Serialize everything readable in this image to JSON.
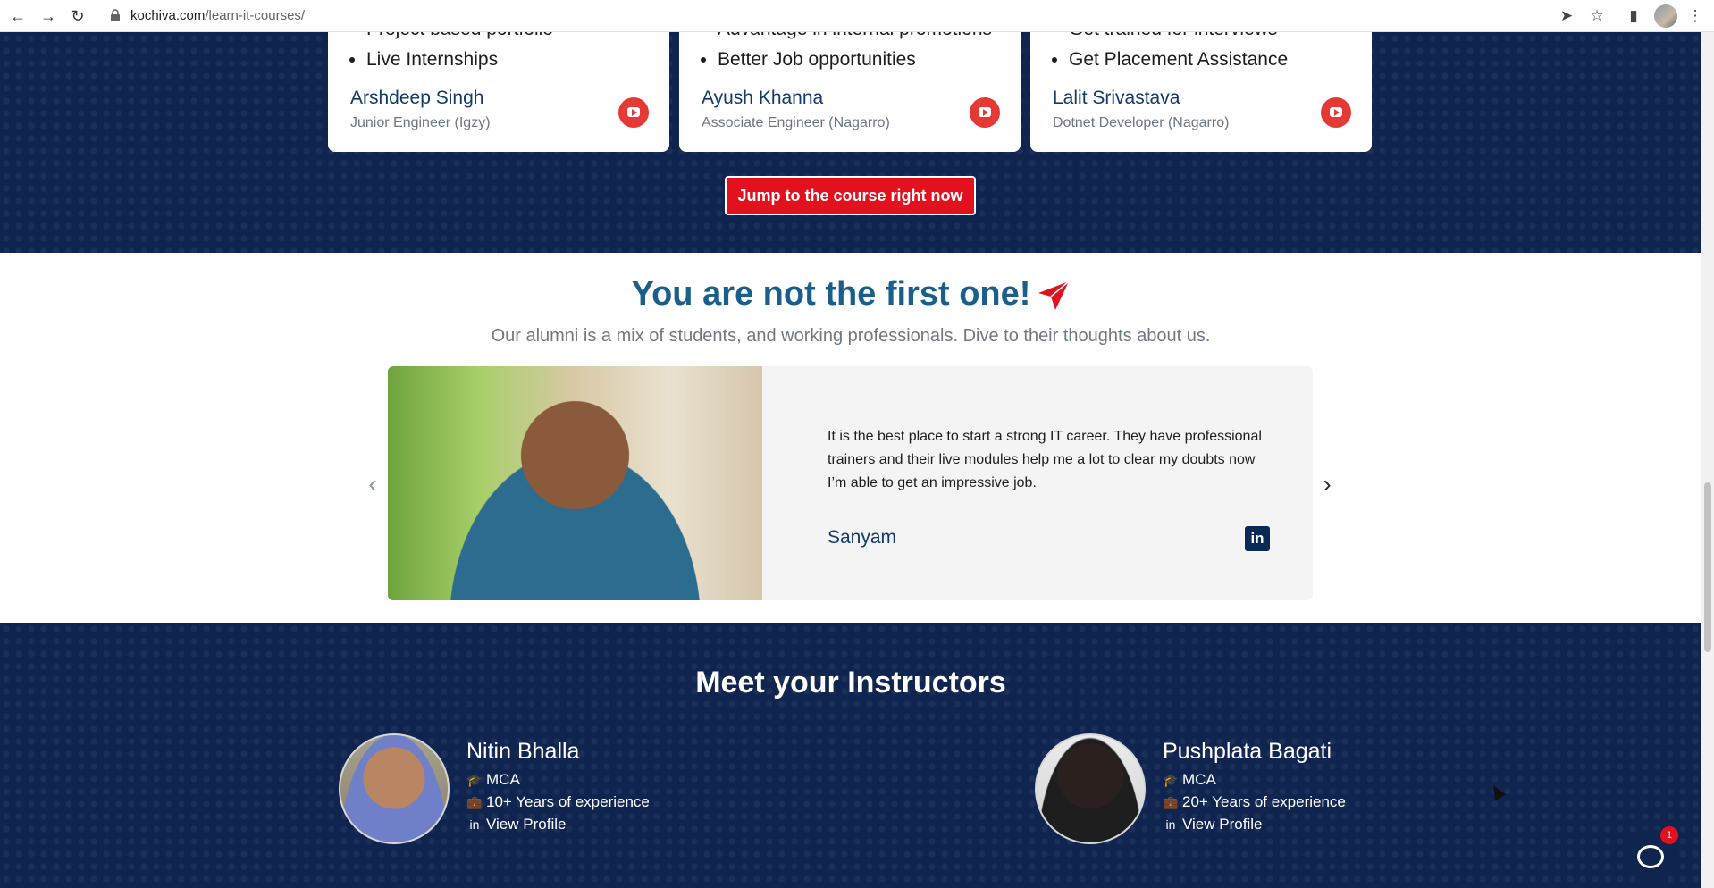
{
  "browser": {
    "url_host": "kochiva.com",
    "url_path": "/learn-it-courses/",
    "icons": [
      "back-arrow-icon",
      "forward-arrow-icon",
      "reload-icon",
      "lock-icon",
      "send-icon",
      "star-icon",
      "sidebar-icon",
      "profile-avatar",
      "menu-kebab-icon"
    ]
  },
  "cards": [
    {
      "top_item": "Project based portfolio",
      "item": "Live Internships",
      "name": "Arshdeep Singh",
      "role": "Junior Engineer (Igzy)"
    },
    {
      "top_item": "Advantage in internal promotions",
      "item": "Better Job opportunities",
      "name": "Ayush Khanna",
      "role": "Associate Engineer (Nagarro)"
    },
    {
      "top_item": "Get trained for interviews",
      "item": "Get Placement Assistance",
      "name": "Lalit Srivastava",
      "role": "Dotnet Developer (Nagarro)"
    }
  ],
  "jump_button": "Jump to the course right now",
  "testimonials": {
    "title": "You are not the first one!",
    "subtitle": "Our alumni is a mix of students, and working professionals. Dive to their thoughts about us.",
    "quote": "It is the best place to start a strong IT career. They have professional trainers and their live modules help me a lot to clear my doubts now I’m able to get an impressive job.",
    "name": "Sanyam",
    "prev": "‹",
    "next": "›"
  },
  "instructors": {
    "title": "Meet your Instructors",
    "people": [
      {
        "name": "Nitin Bhalla",
        "degree": "MCA",
        "experience": "10+ Years of experience",
        "profile": "View Profile"
      },
      {
        "name": "Pushplata Bagati",
        "degree": "MCA",
        "experience": "20+ Years of experience",
        "profile": "View Profile"
      }
    ]
  },
  "chat": {
    "badge": "1"
  },
  "colors": {
    "navy": "#0f2550",
    "red": "#e3101e",
    "title_blue": "#1a5f8c"
  }
}
